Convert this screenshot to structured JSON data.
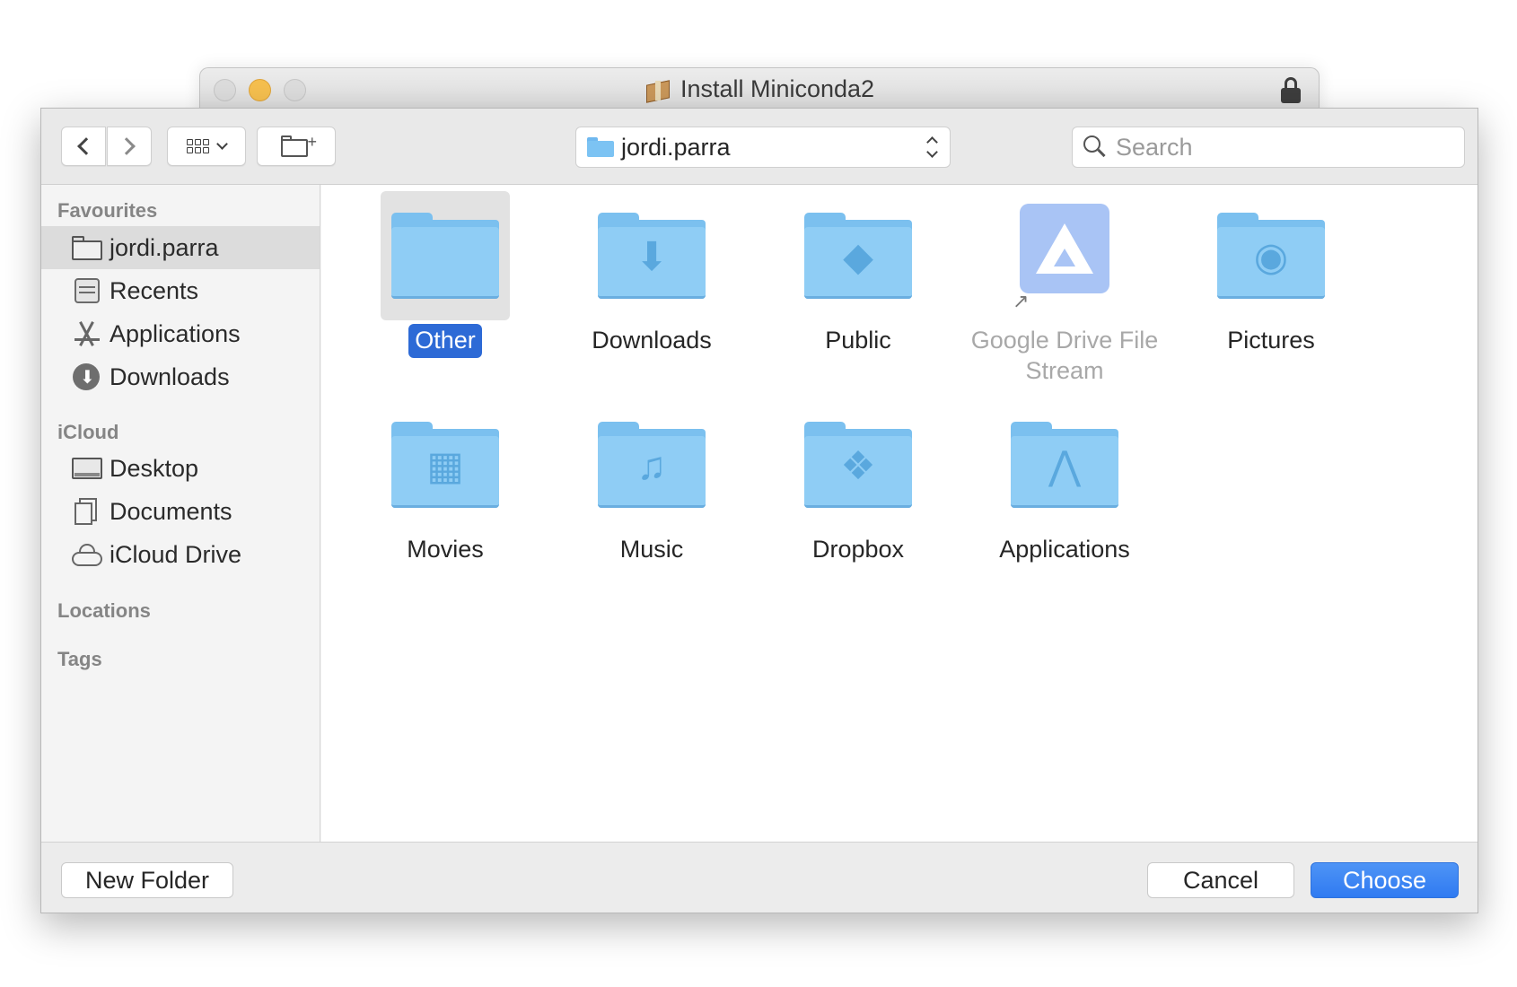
{
  "window": {
    "title": "Install Miniconda2"
  },
  "toolbar": {
    "path_label": "jordi.parra",
    "search_placeholder": "Search"
  },
  "sidebar": {
    "sections": {
      "favourites": "Favourites",
      "icloud": "iCloud",
      "locations": "Locations",
      "tags": "Tags"
    },
    "favourites": [
      {
        "label": "jordi.parra",
        "icon": "folder-icon",
        "selected": true
      },
      {
        "label": "Recents",
        "icon": "recents-icon"
      },
      {
        "label": "Applications",
        "icon": "applications-icon"
      },
      {
        "label": "Downloads",
        "icon": "downloads-icon"
      }
    ],
    "icloud": [
      {
        "label": "Desktop",
        "icon": "desktop-icon"
      },
      {
        "label": "Documents",
        "icon": "documents-icon"
      },
      {
        "label": "iCloud Drive",
        "icon": "icloud-drive-icon"
      }
    ]
  },
  "content": {
    "items": [
      {
        "label": "Other",
        "icon": "folder-icon",
        "selected": true
      },
      {
        "label": "Downloads",
        "icon": "downloads-folder-icon"
      },
      {
        "label": "Public",
        "icon": "public-folder-icon"
      },
      {
        "label": "Google Drive File Stream",
        "icon": "google-drive-icon",
        "dimmed": true
      },
      {
        "label": "Pictures",
        "icon": "pictures-folder-icon"
      },
      {
        "label": "Movies",
        "icon": "movies-folder-icon"
      },
      {
        "label": "Music",
        "icon": "music-folder-icon"
      },
      {
        "label": "Dropbox",
        "icon": "dropbox-folder-icon"
      },
      {
        "label": "Applications",
        "icon": "applications-folder-icon"
      }
    ]
  },
  "footer": {
    "new_folder": "New Folder",
    "cancel": "Cancel",
    "choose": "Choose"
  },
  "colors": {
    "accent": "#2d6ad6",
    "folder": "#8fcdf5",
    "choose_button": "#3a82f4"
  }
}
